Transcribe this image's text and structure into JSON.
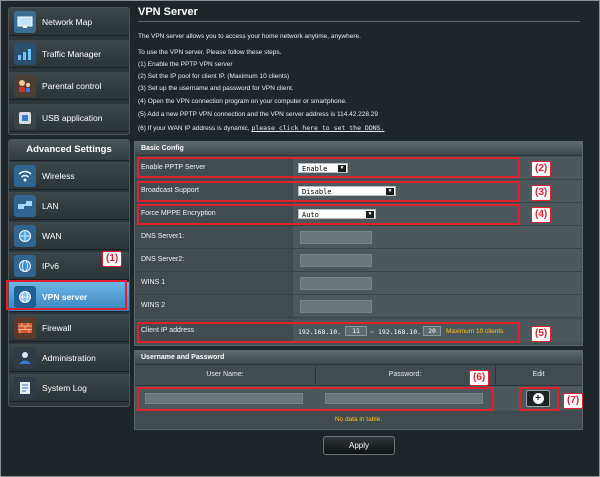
{
  "sidebar": {
    "top_items": [
      {
        "label": "Network Map",
        "icon": "network-map-icon"
      },
      {
        "label": "Traffic Manager",
        "icon": "traffic-manager-icon"
      },
      {
        "label": "Parental control",
        "icon": "parental-control-icon"
      },
      {
        "label": "USB application",
        "icon": "usb-application-icon"
      }
    ],
    "advanced_header": "Advanced Settings",
    "advanced_items": [
      {
        "label": "Wireless",
        "icon": "wireless-icon"
      },
      {
        "label": "LAN",
        "icon": "lan-icon"
      },
      {
        "label": "WAN",
        "icon": "wan-icon"
      },
      {
        "label": "IPv6",
        "icon": "ipv6-icon"
      },
      {
        "label": "VPN server",
        "icon": "vpn-server-icon",
        "active": true
      },
      {
        "label": "Firewall",
        "icon": "firewall-icon"
      },
      {
        "label": "Administration",
        "icon": "administration-icon"
      },
      {
        "label": "System Log",
        "icon": "system-log-icon"
      }
    ]
  },
  "annotations": {
    "t1": "(1)",
    "t2": "(2)",
    "t3": "(3)",
    "t4": "(4)",
    "t5": "(5)",
    "t6": "(6)",
    "t7": "(7)",
    "color": "#e0202e"
  },
  "page": {
    "title": "VPN Server",
    "description": "The VPN server allows you to access your home network anytime, anywhere.",
    "steps_intro": "To use the VPN server. Please follow these steps.",
    "steps": [
      "(1) Enable the PPTP VPN server",
      "(2) Set the IP pool for client IP. (Maximum 10 clients)",
      "(3) Set up the username and password for VPN client.",
      "(4) Open the VPN connection program on your computer or smartphone.",
      "(5) Add a new PPTP VPN connection and the VPN server address is 114.42.228.29"
    ],
    "step6_prefix": "(6) If your WAN IP address is dynamic,",
    "step6_link": "please click here to set the DDNS."
  },
  "basic_config": {
    "header": "Basic Config",
    "enable_pptp_label": "Enable PPTP Server",
    "enable_pptp_value": "Enable",
    "broadcast_label": "Broadcast Support",
    "broadcast_value": "Disable",
    "mppe_label": "Force MPPE Encryption",
    "mppe_value": "Auto",
    "dns1_label": "DNS Server1:",
    "dns2_label": "DNS Server2:",
    "wins1_label": "WINS 1",
    "wins2_label": "WINS 2",
    "client_ip_label": "Client IP address",
    "ip_prefix_start": "192.168.10.",
    "ip_start": "11",
    "ip_separator": "~",
    "ip_prefix_end": "192.168.10.",
    "ip_end": "20",
    "max_clients": "Maximum 10 clients"
  },
  "user_table": {
    "header": "Username and Password",
    "col_user": "User Name:",
    "col_password": "Password:",
    "col_edit": "Edit",
    "empty_text": "No data in table."
  },
  "apply_label": "Apply"
}
